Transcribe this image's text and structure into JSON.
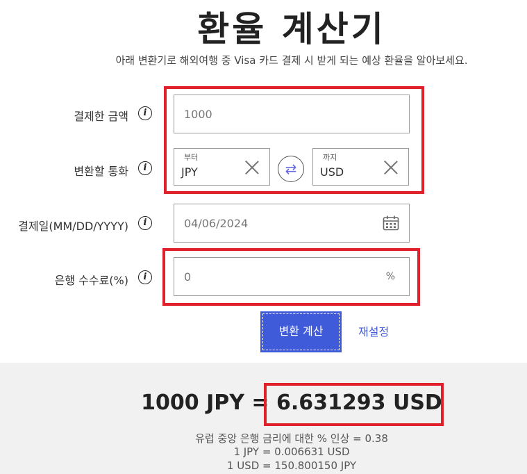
{
  "header": {
    "title": "환율 계산기",
    "subtitle": "아래 변환기로 해외여행 중 Visa 카드 결제 시 받게 되는 예상 환율을 알아보세요."
  },
  "form": {
    "amount": {
      "label": "결제한 금액",
      "value": "1000"
    },
    "currency": {
      "label": "변환할 통화",
      "from_label": "부터",
      "from_value": "JPY",
      "to_label": "까지",
      "to_value": "USD"
    },
    "date": {
      "label": "결제일(MM/DD/YYYY)",
      "value": "04/06/2024"
    },
    "fee": {
      "label": "은행 수수료(%)",
      "value": "0",
      "suffix": "%"
    },
    "convert_label": "변환 계산",
    "reset_label": "재설정"
  },
  "result": {
    "main_left": "1000 JPY = ",
    "main_right": "6.631293 USD",
    "ecb_line": "유럽 중앙 은행 금리에 대한 % 인상 = 0.38",
    "rate_line_1": "1 JPY = 0.006631 USD",
    "rate_line_2": "1 USD = 150.800150 JPY"
  },
  "colors": {
    "accent": "#3f5bd9",
    "highlight": "#e0202b",
    "panel": "#f1f1f1"
  }
}
